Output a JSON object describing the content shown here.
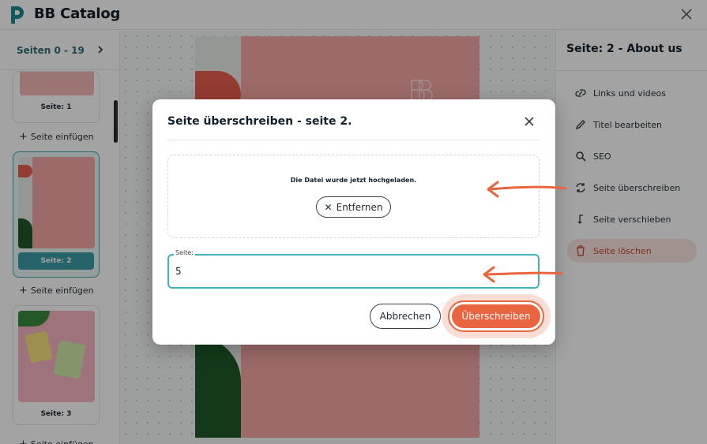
{
  "header": {
    "title": "BB Catalog"
  },
  "sidebar": {
    "pages_range": "Seiten 0 - 19",
    "thumbs": [
      {
        "label": "Seite: 1"
      },
      {
        "label": "Seite: 2"
      },
      {
        "label": "Seite: 3"
      }
    ],
    "insert_label": "Seite einfügen"
  },
  "right_panel": {
    "title": "Seite: 2 - About us",
    "items": [
      {
        "label": "Links und videos",
        "icon": "link-icon"
      },
      {
        "label": "Titel bearbeiten",
        "icon": "pencil-icon"
      },
      {
        "label": "SEO",
        "icon": "magnifier-icon"
      },
      {
        "label": "Seite überschreiben",
        "icon": "refresh-icon"
      },
      {
        "label": "Seite verschieben",
        "icon": "move-icon"
      },
      {
        "label": "Seite löschen",
        "icon": "trash-icon"
      }
    ]
  },
  "dialog": {
    "title": "Seite überschreiben - seite 2.",
    "upload_message": "Die Datei wurde jetzt hochgeladen.",
    "remove_label": "Entfernen",
    "field_label": "Seite:",
    "field_value": "5",
    "cancel_label": "Abbrechen",
    "confirm_label": "Überschreiben"
  },
  "colors": {
    "accent": "#3a9ea5",
    "primary_action": "#e9653f",
    "annotation_arrow": "#e9653f"
  }
}
